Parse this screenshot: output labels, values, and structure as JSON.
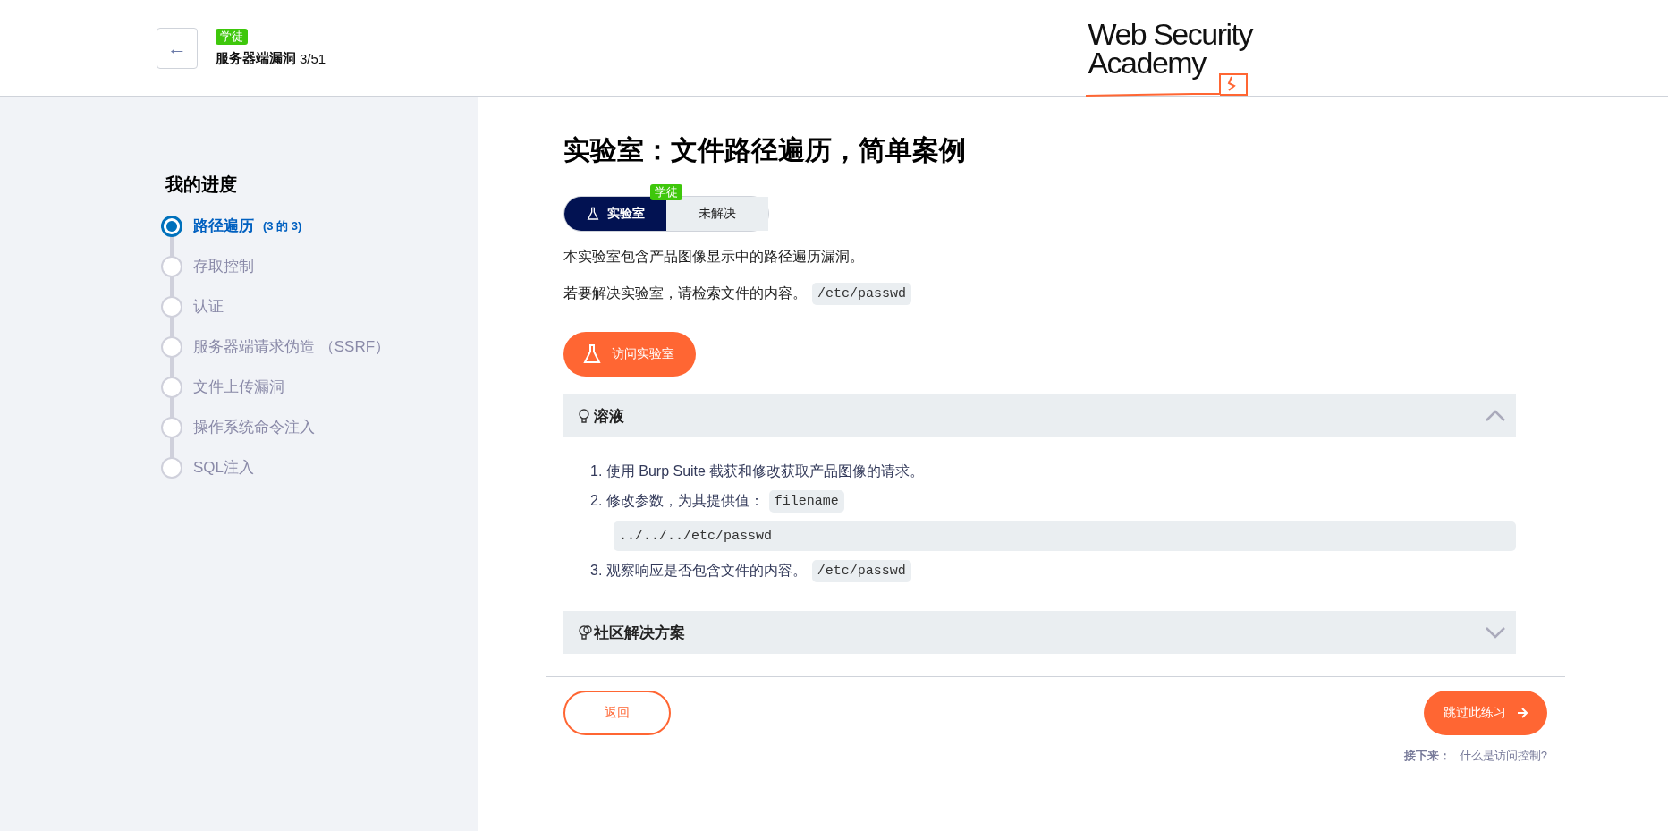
{
  "header": {
    "back_button": "←",
    "badge": "学徒",
    "course": "服务器端漏洞",
    "progress": "3/51",
    "logo": [
      "Web Security",
      "Academy"
    ]
  },
  "sidebar": {
    "title": "我的进度",
    "items": [
      {
        "label": "路径遍历",
        "count": "(3 的 3)",
        "selected": true
      },
      {
        "label": "存取控制",
        "selected": false
      },
      {
        "label": "认证",
        "selected": false
      },
      {
        "label": "服务器端请求伪造 （SSRF）",
        "selected": false
      },
      {
        "label": "文件上传漏洞",
        "selected": false
      },
      {
        "label": "操作系统命令注入",
        "selected": false
      },
      {
        "label": "SQL注入",
        "selected": false
      }
    ]
  },
  "main": {
    "title": "实验室：文件路径遍历，简单案例",
    "level_badge": "学徒",
    "status": [
      {
        "label": "实验室",
        "selected": true
      },
      {
        "label": "未解决",
        "selected": false
      }
    ],
    "paragraphs": [
      {
        "text": "本实验室包含产品图像显示中的路径遍历漏洞。"
      },
      {
        "text": "若要解决实验室，请检索文件的内容。",
        "code": "/etc/passwd"
      }
    ],
    "visit_button": "访问实验室",
    "sections": [
      {
        "title": "溶液",
        "expanded": true,
        "steps": [
          {
            "number": "1.",
            "text": "使用 Burp Suite 截获和修改获取产品图像的请求。"
          },
          {
            "number": "2.",
            "text": "修改参数，为其提供值：",
            "code": "filename",
            "code_block": "../../../etc/passwd"
          },
          {
            "number": "3.",
            "text": "观察响应是否包含文件的内容。",
            "code": "/etc/passwd"
          }
        ]
      },
      {
        "title": "社区解决方案",
        "expanded": false
      }
    ]
  },
  "footer": {
    "back_button": "返回",
    "skip_button": "跳过此练习",
    "next_label": "接下来：",
    "next_link": "什么是访问控制?"
  }
}
